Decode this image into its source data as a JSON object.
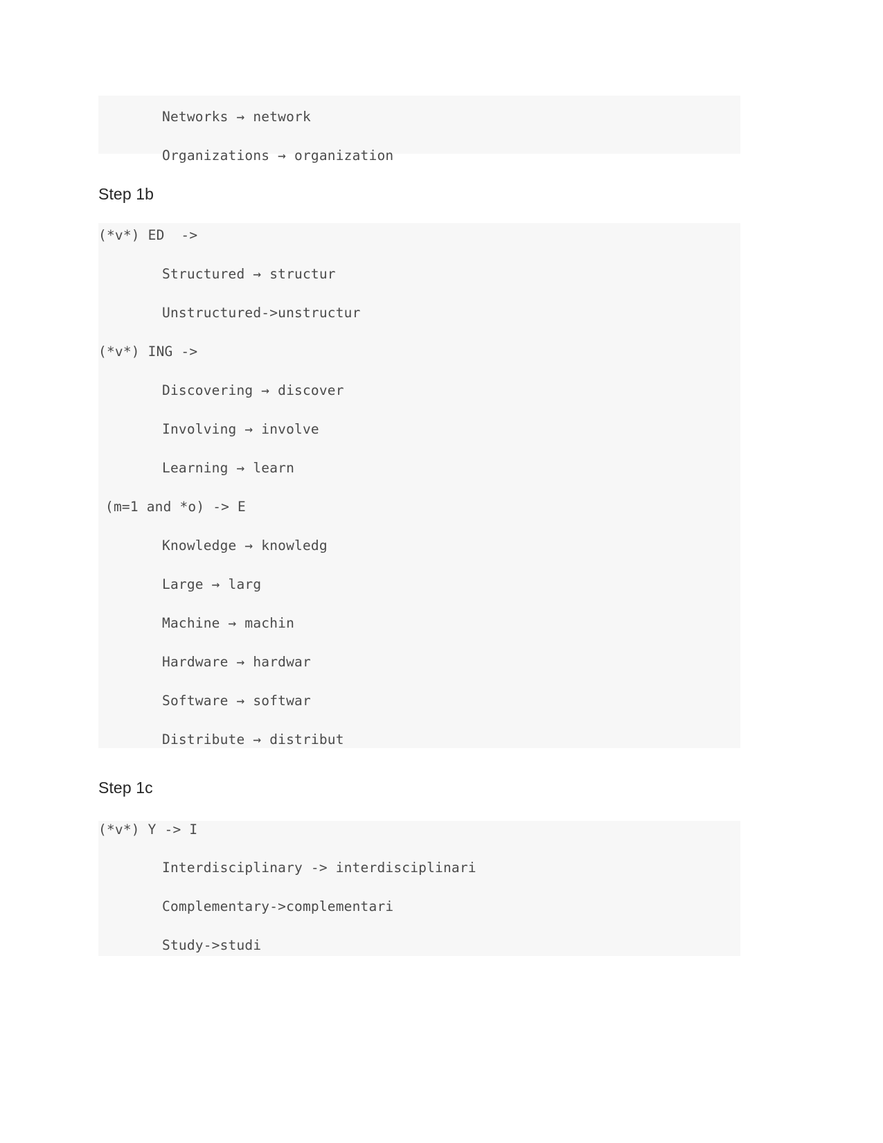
{
  "document": {
    "page_background": "#ffffff",
    "code_block_background": "#f7f7f7",
    "code_text_color": "#4a4a4a",
    "heading_color": "#262626"
  },
  "blocks": [
    {
      "id": "block-step1a-tail",
      "lines": [
        {
          "text": "Networks → network",
          "style": "indent"
        },
        {
          "text": "Organizations → organization",
          "style": "indent"
        }
      ]
    },
    {
      "id": "block-step1b",
      "lines": [
        {
          "text": "(*v*) ED  ->",
          "style": "rule"
        },
        {
          "text": "Structured → structur",
          "style": "indent"
        },
        {
          "text": "Unstructured->unstructur",
          "style": "indent"
        },
        {
          "text": "(*v*) ING ->",
          "style": "rule"
        },
        {
          "text": "Discovering → discover",
          "style": "indent"
        },
        {
          "text": "Involving → involve",
          "style": "indent"
        },
        {
          "text": "Learning → learn",
          "style": "indent"
        },
        {
          "text": "(m=1 and *o) -> E",
          "style": "rule-pad"
        },
        {
          "text": "Knowledge → knowledg",
          "style": "indent"
        },
        {
          "text": "Large → larg",
          "style": "indent"
        },
        {
          "text": "Machine → machin",
          "style": "indent"
        },
        {
          "text": "Hardware → hardwar",
          "style": "indent"
        },
        {
          "text": "Software → softwar",
          "style": "indent"
        },
        {
          "text": "Distribute → distribut",
          "style": "indent"
        }
      ]
    },
    {
      "id": "block-step1c",
      "lines": [
        {
          "text": "(*v*) Y -> I",
          "style": "rule"
        },
        {
          "text": "Interdisciplinary -> interdisciplinari",
          "style": "indent"
        },
        {
          "text": "Complementary->complementari",
          "style": "indent"
        },
        {
          "text": "Study->studi",
          "style": "indent"
        }
      ]
    }
  ],
  "headings": {
    "step_1b": "Step 1b",
    "step_1c": "Step 1c"
  }
}
